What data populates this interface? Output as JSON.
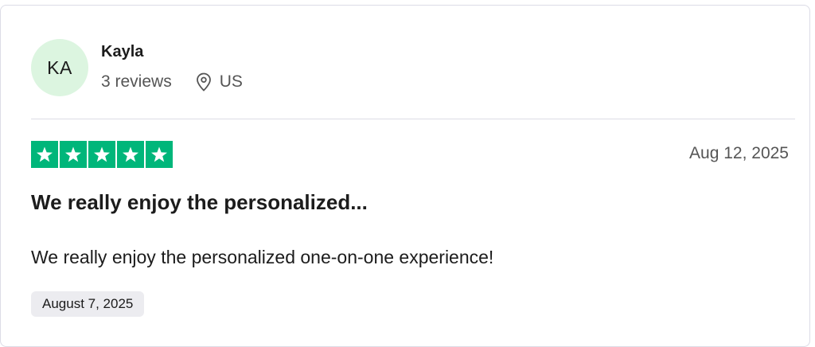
{
  "review": {
    "consumer": {
      "initials": "KA",
      "name": "Kayla",
      "reviews_count": "3 reviews",
      "country": "US",
      "avatar_color": "#dcf5e0"
    },
    "rating": {
      "stars": 5,
      "max": 5,
      "color": "#00b67a",
      "icon": "star-icon"
    },
    "published_date": "Aug 12, 2025",
    "title": "We really enjoy the personalized...",
    "body": "We really enjoy the personalized one-on-one experience!",
    "date_of_experience": "August 7, 2025"
  }
}
